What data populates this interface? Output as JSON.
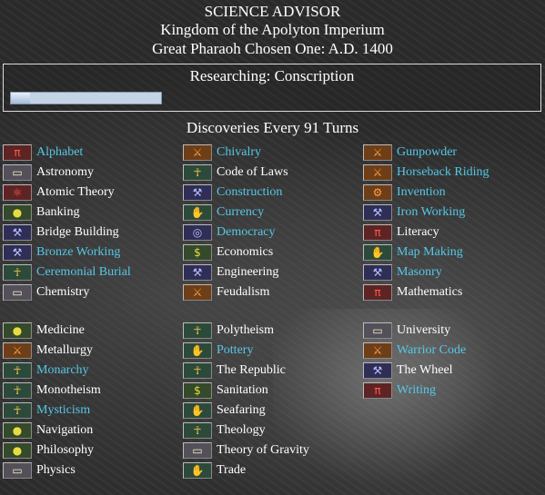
{
  "header": {
    "title": "SCIENCE ADVISOR",
    "kingdom": "Kingdom of the Apolyton Imperium",
    "ruler_date": "Great Pharaoh Chosen One: A.D. 1400"
  },
  "research": {
    "label": "Researching: Conscription",
    "progress_fraction": 0.13
  },
  "discovery_rate": "Discoveries Every 91 Turns",
  "colors": {
    "known_text": "#ffffff",
    "prerequisite_text": "#55c8e8"
  },
  "advances": [
    {
      "name": "Alphabet",
      "icon": "academic-icon",
      "status": "prerequisite"
    },
    {
      "name": "Astronomy",
      "icon": "book-icon",
      "status": "known"
    },
    {
      "name": "Atomic Theory",
      "icon": "atom-icon",
      "status": "known"
    },
    {
      "name": "Banking",
      "icon": "coins-icon",
      "status": "known"
    },
    {
      "name": "Bridge Building",
      "icon": "wrench-icon",
      "status": "known"
    },
    {
      "name": "Bronze Working",
      "icon": "wrench-icon",
      "status": "prerequisite"
    },
    {
      "name": "Ceremonial Burial",
      "icon": "ankh-icon",
      "status": "prerequisite"
    },
    {
      "name": "Chemistry",
      "icon": "book-icon",
      "status": "known"
    },
    {
      "name": "Chivalry",
      "icon": "sword-icon",
      "status": "prerequisite"
    },
    {
      "name": "Code of Laws",
      "icon": "ankh-icon",
      "status": "known"
    },
    {
      "name": "Construction",
      "icon": "wrench-icon",
      "status": "prerequisite"
    },
    {
      "name": "Currency",
      "icon": "hand-icon",
      "status": "prerequisite"
    },
    {
      "name": "Democracy",
      "icon": "magnifier-icon",
      "status": "prerequisite"
    },
    {
      "name": "Economics",
      "icon": "banknote-icon",
      "status": "known"
    },
    {
      "name": "Engineering",
      "icon": "wrench-icon",
      "status": "known"
    },
    {
      "name": "Feudalism",
      "icon": "sword-icon",
      "status": "known"
    },
    {
      "name": "Gunpowder",
      "icon": "sword-icon",
      "status": "prerequisite"
    },
    {
      "name": "Horseback Riding",
      "icon": "sword-icon",
      "status": "prerequisite"
    },
    {
      "name": "Invention",
      "icon": "gears-icon",
      "status": "prerequisite"
    },
    {
      "name": "Iron Working",
      "icon": "wrench-icon",
      "status": "prerequisite"
    },
    {
      "name": "Literacy",
      "icon": "academic-icon",
      "status": "known"
    },
    {
      "name": "Map Making",
      "icon": "hand-icon",
      "status": "prerequisite"
    },
    {
      "name": "Masonry",
      "icon": "wrench-icon",
      "status": "prerequisite"
    },
    {
      "name": "Mathematics",
      "icon": "academic-icon",
      "status": "known"
    },
    {
      "name": "Medicine",
      "icon": "coins-icon",
      "status": "known"
    },
    {
      "name": "Metallurgy",
      "icon": "sword-icon",
      "status": "known"
    },
    {
      "name": "Monarchy",
      "icon": "ankh-icon",
      "status": "prerequisite"
    },
    {
      "name": "Monotheism",
      "icon": "ankh-icon",
      "status": "known"
    },
    {
      "name": "Mysticism",
      "icon": "ankh-icon",
      "status": "prerequisite"
    },
    {
      "name": "Navigation",
      "icon": "coins-icon",
      "status": "known"
    },
    {
      "name": "Philosophy",
      "icon": "coins-icon",
      "status": "known"
    },
    {
      "name": "Physics",
      "icon": "book-icon",
      "status": "known"
    },
    {
      "name": "Polytheism",
      "icon": "ankh-icon",
      "status": "known"
    },
    {
      "name": "Pottery",
      "icon": "hand-icon",
      "status": "prerequisite"
    },
    {
      "name": "The Republic",
      "icon": "ankh-icon",
      "status": "known"
    },
    {
      "name": "Sanitation",
      "icon": "banknote-icon",
      "status": "known"
    },
    {
      "name": "Seafaring",
      "icon": "hand-icon",
      "status": "known"
    },
    {
      "name": "Theology",
      "icon": "ankh-icon",
      "status": "known"
    },
    {
      "name": "Theory of Gravity",
      "icon": "book-icon",
      "status": "known"
    },
    {
      "name": "Trade",
      "icon": "hand-icon",
      "status": "known"
    },
    {
      "name": "University",
      "icon": "book-icon",
      "status": "known"
    },
    {
      "name": "Warrior Code",
      "icon": "sword-icon",
      "status": "prerequisite"
    },
    {
      "name": "The Wheel",
      "icon": "wrench-icon",
      "status": "known"
    },
    {
      "name": "Writing",
      "icon": "academic-icon",
      "status": "prerequisite"
    }
  ]
}
